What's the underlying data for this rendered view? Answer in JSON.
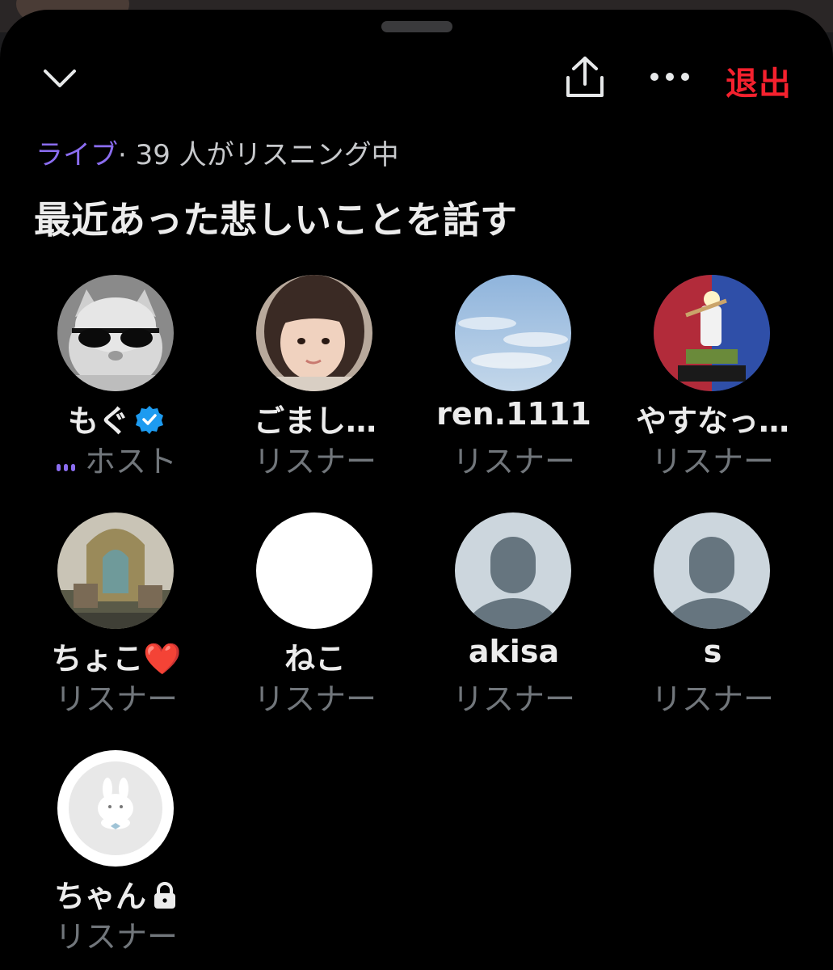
{
  "header": {
    "leave_label": "退出",
    "icons": [
      "chevron-down-icon",
      "share-icon",
      "more-icon"
    ]
  },
  "space": {
    "status_live": "ライブ",
    "status_rest": "· 39 人がリスニング中",
    "title": "最近あった悲しいことを話す"
  },
  "participants": [
    {
      "name": "もぐ",
      "role": "ホスト",
      "verified": true,
      "avatar": "cat-sunglasses"
    },
    {
      "name": "ごまし…",
      "role": "リスナー",
      "avatar": "girl-photo"
    },
    {
      "name": "ren.1111",
      "role": "リスナー",
      "avatar": "sky"
    },
    {
      "name": "やすなっ…",
      "role": "リスナー",
      "avatar": "baseball-card"
    },
    {
      "name": "ちょこ",
      "role": "リスナー",
      "emoji": "❤️",
      "avatar": "fantasy-building"
    },
    {
      "name": "ねこ",
      "role": "リスナー",
      "avatar": "white"
    },
    {
      "name": "akisa",
      "role": "リスナー",
      "avatar": "default"
    },
    {
      "name": "s",
      "role": "リスナー",
      "avatar": "default"
    },
    {
      "name": "ちゃん",
      "role": "リスナー",
      "locked": true,
      "avatar": "bunny"
    }
  ],
  "colors": {
    "background": "#000000",
    "accent_live": "#8b6df0",
    "leave": "#f4212e",
    "verified": "#1d9bf0",
    "role_text": "#71767b"
  }
}
